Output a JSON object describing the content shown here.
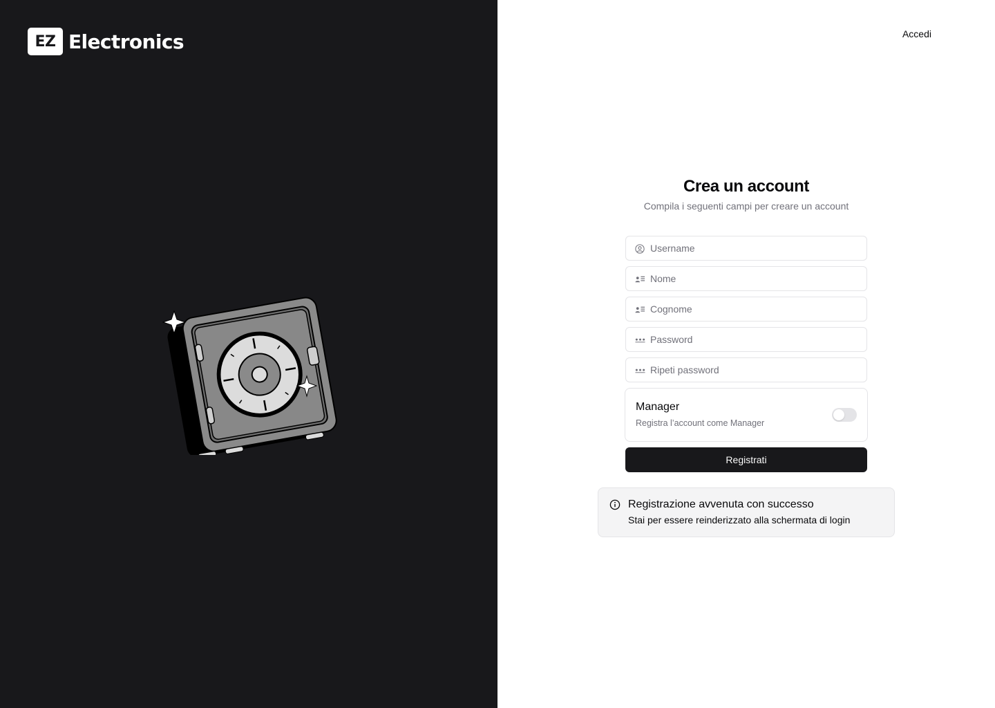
{
  "brand": {
    "mark": "EZ",
    "name": "Electronics"
  },
  "nav": {
    "login_link": "Accedi"
  },
  "form": {
    "title": "Crea un account",
    "subtitle": "Compila i seguenti campi per creare un account",
    "fields": [
      {
        "placeholder": "Username",
        "value": "",
        "icon": "user-circle-icon"
      },
      {
        "placeholder": "Nome",
        "value": "",
        "icon": "id-card-icon"
      },
      {
        "placeholder": "Cognome",
        "value": "",
        "icon": "id-card-icon"
      },
      {
        "placeholder": "Password",
        "value": "",
        "icon": "password-dots-icon"
      },
      {
        "placeholder": "Ripeti password",
        "value": "",
        "icon": "password-dots-icon"
      }
    ],
    "manager": {
      "title": "Manager",
      "description": "Registra l’account come Manager",
      "enabled": false
    },
    "submit_label": "Registrati"
  },
  "alert": {
    "icon": "info-icon",
    "title": "Registrazione avvenuta con successo",
    "description": "Stai per essere reinderizzato alla schermata di login"
  },
  "colors": {
    "dark_panel": "#18181b",
    "primary_button": "#18181b",
    "muted_text": "#71717a",
    "border": "#e4e4e7",
    "alert_bg": "#f4f4f5"
  }
}
